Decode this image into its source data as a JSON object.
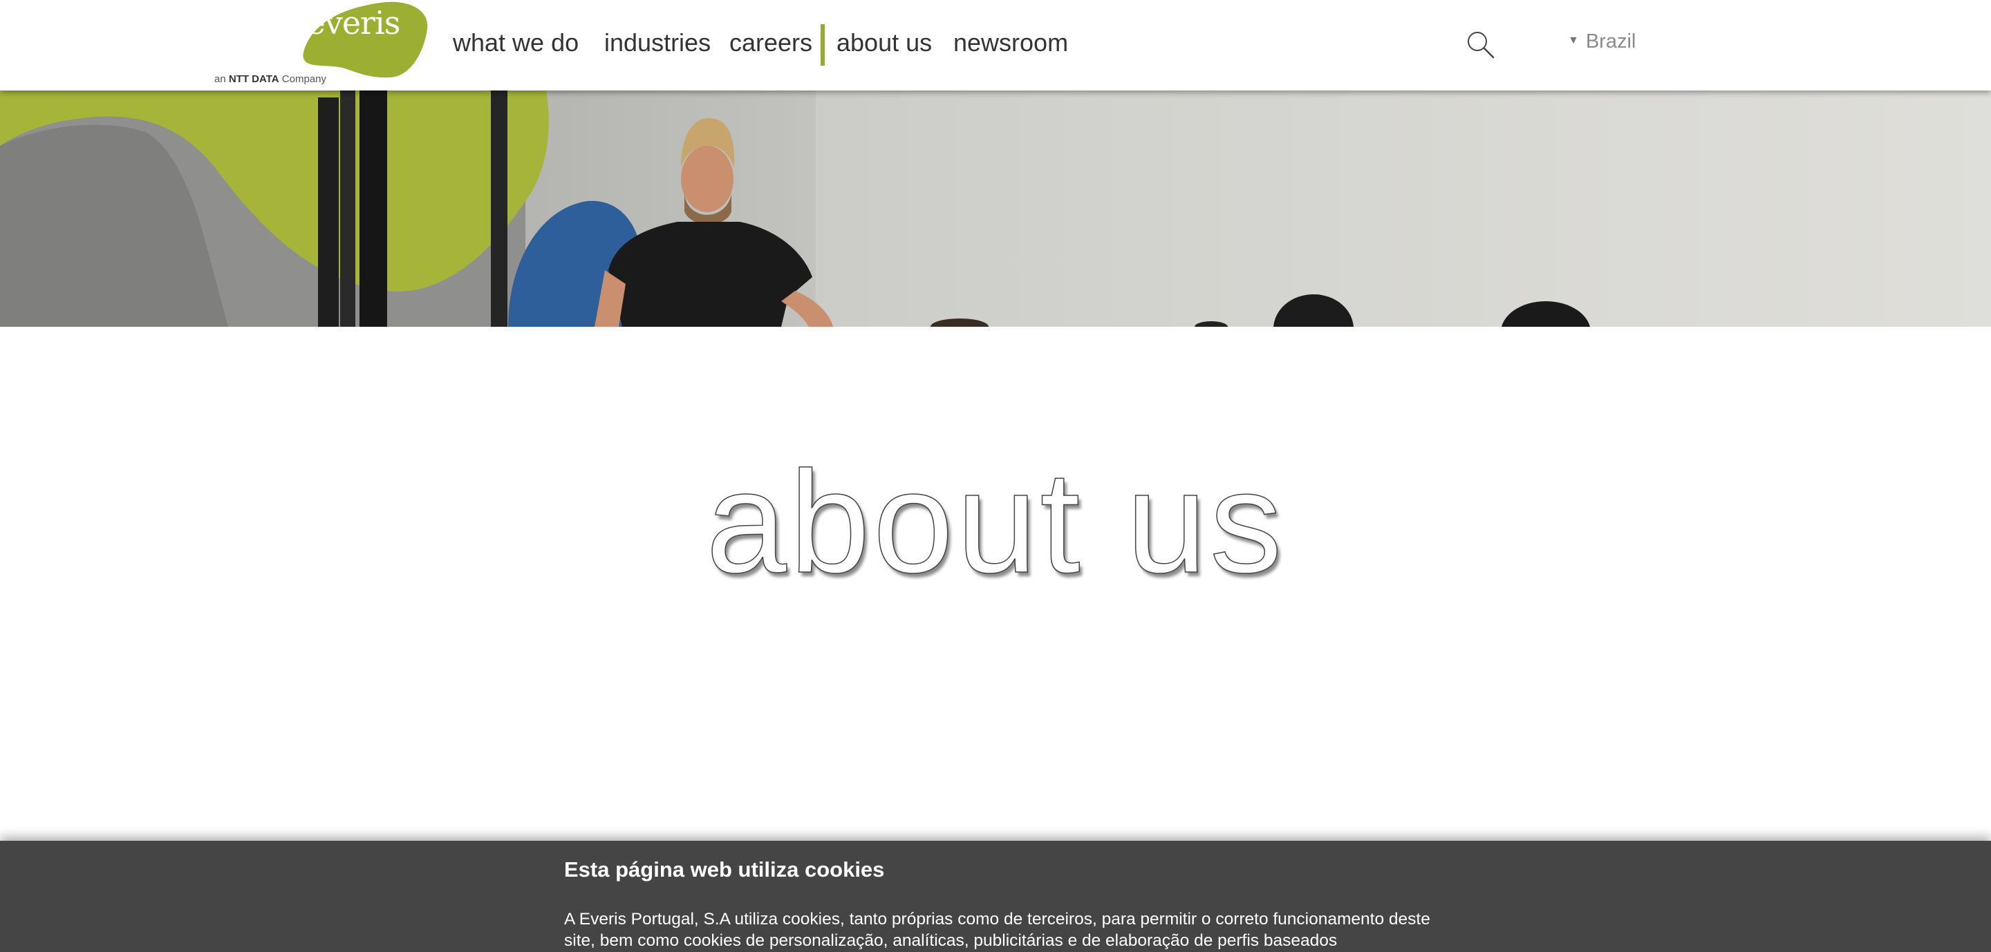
{
  "header": {
    "logo_text": "everis",
    "logo_subtitle_prefix": "an",
    "logo_subtitle_brand": "NTT DATA",
    "logo_subtitle_suffix": "Company",
    "nav": [
      {
        "label": "what we do"
      },
      {
        "label": "industries"
      },
      {
        "label": "careers"
      },
      {
        "label": "about us"
      },
      {
        "label": "newsroom"
      }
    ],
    "active_nav": "about us",
    "search_icon": "search-icon",
    "country_label": "Brazil",
    "country_caret_icon": "caret-down-icon"
  },
  "hero": {
    "image_description_icon": "hero-photo"
  },
  "page": {
    "title": "about us"
  },
  "cookie_banner": {
    "title": "Esta página web utiliza cookies",
    "text": "A Everis Portugal, S.A utiliza cookies, tanto próprias como de terceiros, para permitir o correto funcionamento deste site, bem como cookies de personalização, analíticas, publicitárias e de elaboração de perfis baseados"
  },
  "colors": {
    "accent": "#97a92f",
    "banner_bg": "#454545",
    "nav_text": "#333333"
  }
}
